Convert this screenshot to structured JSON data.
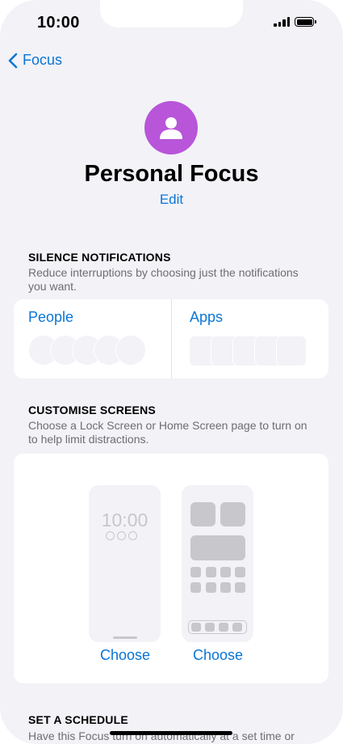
{
  "status_bar": {
    "time": "10:00"
  },
  "nav": {
    "back_label": "Focus"
  },
  "header": {
    "title": "Personal Focus",
    "edit_label": "Edit"
  },
  "silence": {
    "heading": "SILENCE NOTIFICATIONS",
    "description": "Reduce interruptions by choosing just the notifications you want.",
    "people_label": "People",
    "apps_label": "Apps"
  },
  "customise": {
    "heading": "CUSTOMISE SCREENS",
    "description": "Choose a Lock Screen or Home Screen page to turn on to help limit distractions.",
    "lock_preview_time": "10:00",
    "lock_choose_label": "Choose",
    "home_choose_label": "Choose"
  },
  "schedule": {
    "heading": "SET A SCHEDULE",
    "description": "Have this Focus turn on automatically at a set time or"
  },
  "colors": {
    "accent": "#0a75d5",
    "avatar": "#b855d9",
    "background": "#f2f2f7"
  },
  "icons": {
    "back": "chevron-left-icon",
    "avatar": "person-icon"
  }
}
